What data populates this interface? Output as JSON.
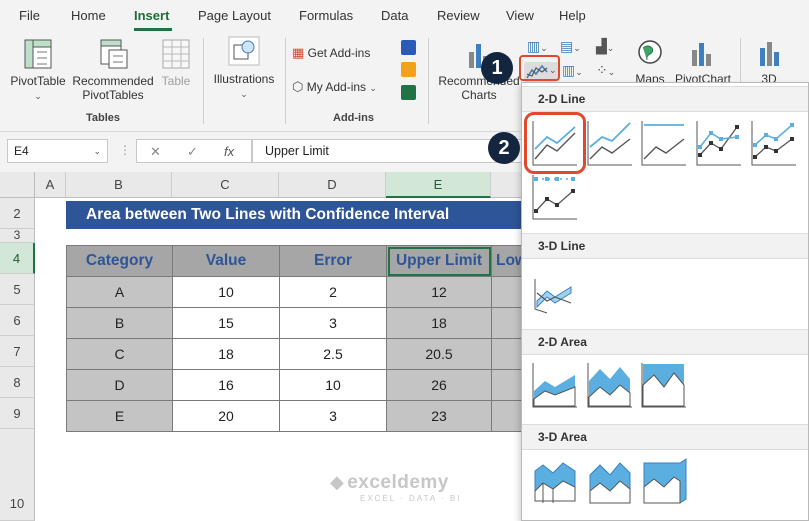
{
  "menu": {
    "tabs": [
      "File",
      "Home",
      "Insert",
      "Page Layout",
      "Formulas",
      "Data",
      "Review",
      "View",
      "Help"
    ],
    "active": "Insert"
  },
  "ribbon": {
    "pivot_table": "PivotTable",
    "recommended_pivot_1": "Recommended",
    "recommended_pivot_2": "PivotTables",
    "table": "Table",
    "tables_group": "Tables",
    "illustrations": "Illustrations",
    "get_addins": "Get Add-ins",
    "my_addins": "My Add-ins",
    "addins_group": "Add-ins",
    "recommended_charts_1": "Recommended",
    "recommended_charts_2": "Charts",
    "maps": "Maps",
    "pivot_chart": "PivotChart",
    "three_d": "3D"
  },
  "formula_bar": {
    "name_box": "E4",
    "fx": "fx",
    "formula": "Upper Limit"
  },
  "sheet": {
    "columns": [
      "A",
      "B",
      "C",
      "D",
      "E"
    ],
    "rows": [
      "2",
      "3",
      "4",
      "5",
      "6",
      "7",
      "8",
      "9",
      "10"
    ],
    "title": "Area between Two Lines with Confidence Interval",
    "headers": [
      "Category",
      "Value",
      "Error",
      "Upper Limit",
      "Low"
    ],
    "data": [
      [
        "A",
        "10",
        "2",
        "12"
      ],
      [
        "B",
        "15",
        "3",
        "18"
      ],
      [
        "C",
        "18",
        "2.5",
        "20.5"
      ],
      [
        "D",
        "16",
        "10",
        "26"
      ],
      [
        "E",
        "20",
        "3",
        "23"
      ]
    ]
  },
  "dropdown": {
    "sections": {
      "line_2d": "2-D Line",
      "line_3d": "3-D Line",
      "area_2d": "2-D Area",
      "area_3d": "3-D Area"
    }
  },
  "callouts": {
    "step1": "1",
    "step2": "2"
  },
  "watermark": {
    "brand": "exceldemy",
    "tagline": "EXCEL · DATA · BI"
  },
  "colors": {
    "accent_green": "#217346",
    "title_blue": "#2e5597",
    "highlight_red": "#e0492b",
    "chart_blue": "#5aaee0"
  }
}
